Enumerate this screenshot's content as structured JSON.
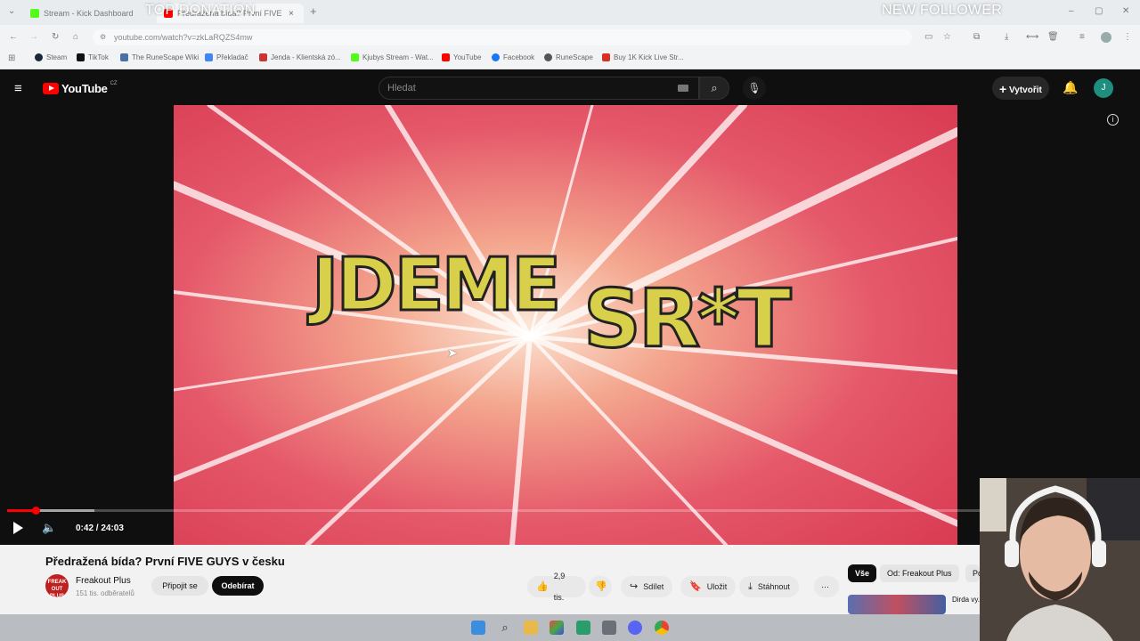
{
  "browser": {
    "tabs": [
      {
        "label": "Stream - Kick Dashboard",
        "color": "#53fc18"
      },
      {
        "label": "Předražená bída? První FIVE GUYS",
        "color": "#ff0000"
      }
    ],
    "new_tab_icon": "plus-icon",
    "url": "youtube.com/watch?v=zkLaRQZS4mw",
    "bookmarks": [
      {
        "label": "Steam",
        "color": "#1b2838"
      },
      {
        "label": "TikTok",
        "color": "#111111"
      },
      {
        "label": "The RuneScape Wiki",
        "color": "#4a6fa5"
      },
      {
        "label": "Překladač",
        "color": "#4285f4"
      },
      {
        "label": "Jenda - Klientská zó...",
        "color": "#cc3333"
      },
      {
        "label": "Kjubys Stream - Wat...",
        "color": "#53fc18"
      },
      {
        "label": "YouTube",
        "color": "#ff0000"
      },
      {
        "label": "Facebook",
        "color": "#1877f2"
      },
      {
        "label": "RuneScape",
        "color": "#555555"
      },
      {
        "label": "Buy 1K Kick Live Str...",
        "color": "#d93025"
      }
    ]
  },
  "overlay": {
    "left": "TOP DONATION",
    "right": "NEW FOLLOWER"
  },
  "youtube": {
    "logo_text": "YouTube",
    "region": "CZ",
    "search_placeholder": "Hledat",
    "create_label": "Vytvořit",
    "avatar_letter": "J"
  },
  "video": {
    "thumbnail_text_line1": "JDEME",
    "thumbnail_text_line2": "SR*T",
    "time": "0:42 / 24:03",
    "progress_fraction": 0.029
  },
  "details": {
    "title": "Předražená bída? První FIVE GUYS v česku",
    "channel": "Freakout Plus",
    "channel_avatar_text": "FREAK OUT PLUS",
    "subscribers": "151 tis. odběratelů",
    "join_label": "Připojit se",
    "subscribe_label": "Odebírat",
    "likes": "2,9 tis.",
    "share_label": "Sdílet",
    "save_label": "Uložit",
    "download_label": "Stáhnout"
  },
  "sidebar": {
    "chips": [
      "Vše",
      "Od: Freakout Plus",
      "Po"
    ],
    "next_video_title": "Dirda vy... Proč Pr..."
  }
}
